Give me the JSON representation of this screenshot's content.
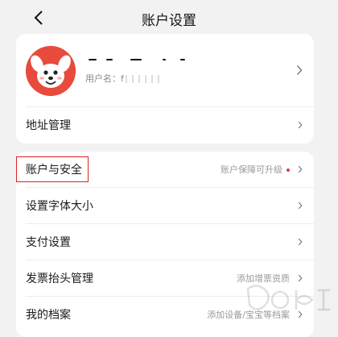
{
  "header": {
    "title": "账户设置",
    "back_icon": "chevron-left-icon"
  },
  "profile": {
    "username_label": "用户名：f",
    "avatar_icon": "jd-dog-mascot-avatar"
  },
  "address_row": {
    "label": "地址管理"
  },
  "settings": [
    {
      "label": "账户与安全",
      "sub": "账户保障可升级",
      "has_dot": true
    },
    {
      "label": "设置字体大小",
      "sub": ""
    },
    {
      "label": "支付设置",
      "sub": ""
    },
    {
      "label": "发票抬头管理",
      "sub": "添加增票资质"
    },
    {
      "label": "我的档案",
      "sub": "添加设备/宝宝等档案"
    }
  ],
  "colors": {
    "accent_red": "#e4393c",
    "highlight_border": "#e02020",
    "avatar_bg": "#e84b3c"
  }
}
